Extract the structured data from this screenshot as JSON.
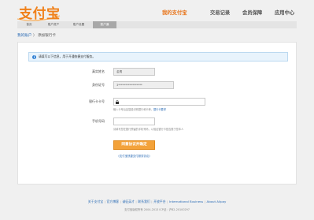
{
  "brand": {
    "logo_text": "支付宝",
    "accent_color": "#f08019",
    "link_color": "#2a6bb5"
  },
  "top_nav": {
    "items": [
      {
        "label": "我的支付宝",
        "active": true
      },
      {
        "label": "交易记录",
        "active": false
      },
      {
        "label": "会员保障",
        "active": false
      },
      {
        "label": "应用中心",
        "active": false
      }
    ]
  },
  "sub_nav": {
    "items": [
      {
        "label": "首页",
        "active": false
      },
      {
        "label": "账户资产",
        "active": false
      },
      {
        "label": "账户设置",
        "active": false
      },
      {
        "label": "账户通",
        "active": true
      }
    ]
  },
  "breadcrumb": {
    "root": "我的账户",
    "separator": "〉",
    "current": "添加银行卡"
  },
  "notice": {
    "icon": "info-icon",
    "text": "请填写以下信息，用于开通快捷支付服务。"
  },
  "form": {
    "name": {
      "label": "真实姓名",
      "value": "金鹰"
    },
    "id_number": {
      "label": "身份证号",
      "value": "3*****************"
    },
    "card_number": {
      "label": "银行卡卡号",
      "value": "",
      "hint": "输入卡号后会智能识别银行和卡种，",
      "hint_link": "银行卡要求"
    },
    "phone": {
      "label": "手机号码",
      "value": "",
      "hint": "请填写您在银行预留的手机号码，以验证银行卡是否属于您本人"
    },
    "submit_label": "同意协议并确定",
    "agreement_link": "《支付宝快捷支付服务协议》"
  },
  "footer": {
    "links": [
      "关于支付宝",
      "官方博客",
      "诚征英才",
      "联系我们",
      "开放平台",
      "International Business",
      "About Alipay"
    ],
    "copyright": "支付宝版权所有 2004-2013 ICP证：沪B2-20100297"
  }
}
